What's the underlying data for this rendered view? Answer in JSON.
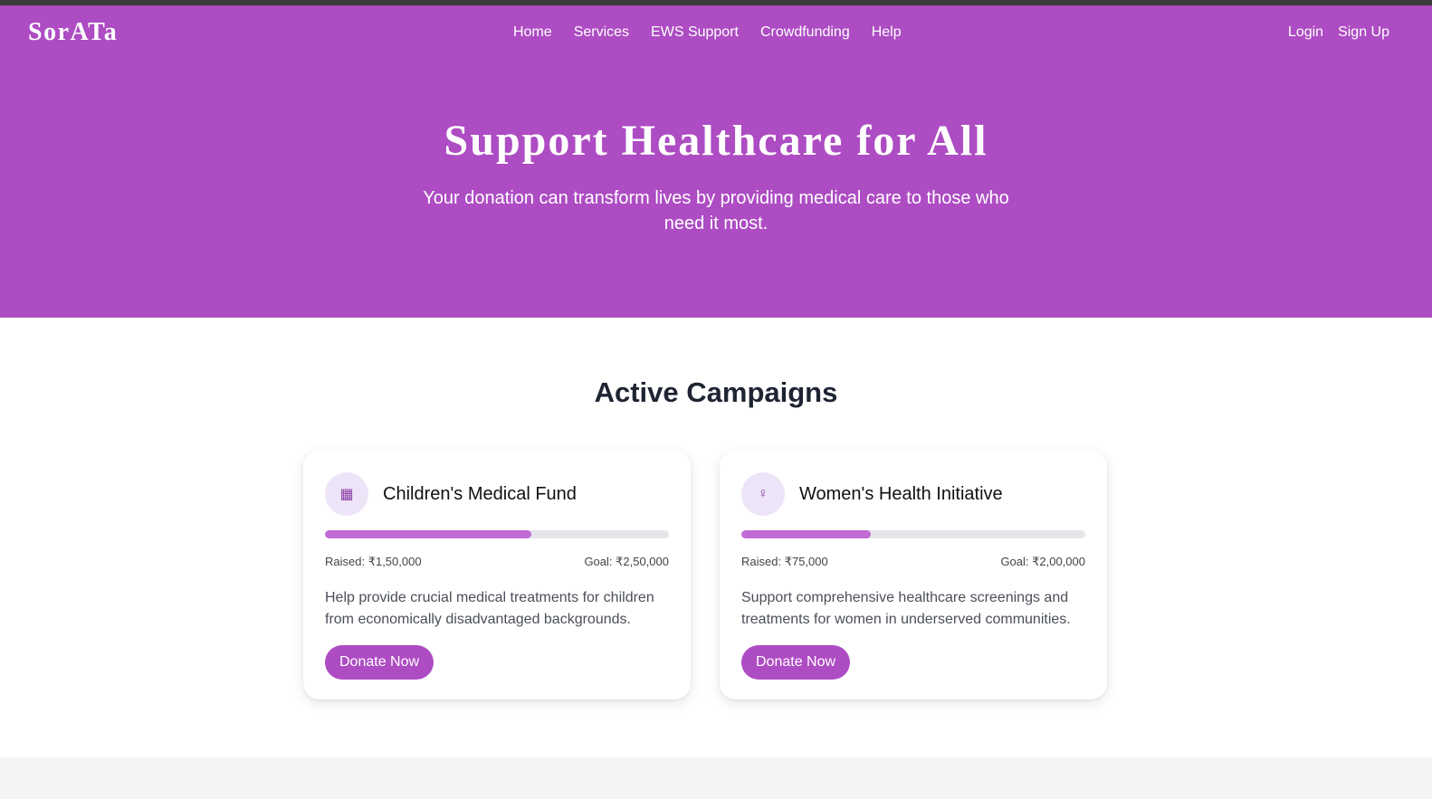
{
  "nav": {
    "logo": "SorATa",
    "links": [
      "Home",
      "Services",
      "EWS Support",
      "Crowdfunding",
      "Help"
    ],
    "login": "Login",
    "signup": "Sign Up"
  },
  "hero": {
    "title": "Support Healthcare for All",
    "subtitle": "Your donation can transform lives by providing medical care to those who need it most."
  },
  "campaigns": {
    "title": "Active Campaigns",
    "items": [
      {
        "icon": "hospital-icon",
        "icon_glyph": "▦",
        "title": "Children's Medical Fund",
        "progress": 0.6,
        "raised": "Raised: ₹1,50,000",
        "goal": "Goal: ₹2,50,000",
        "description": "Help provide crucial medical treatments for children from economically disadvantaged backgrounds.",
        "button": "Donate Now"
      },
      {
        "icon": "woman-icon",
        "icon_glyph": "♀",
        "title": "Women's Health Initiative",
        "progress": 0.375,
        "raised": "Raised: ₹75,000",
        "goal": "Goal: ₹2,00,000",
        "description": "Support comprehensive healthcare screenings and treatments for women in underserved communities.",
        "button": "Donate Now"
      }
    ]
  },
  "colors": {
    "brand": "#ad4cc3",
    "progress_fill": "#c06ad6",
    "progress_track": "#e5e5ea"
  }
}
